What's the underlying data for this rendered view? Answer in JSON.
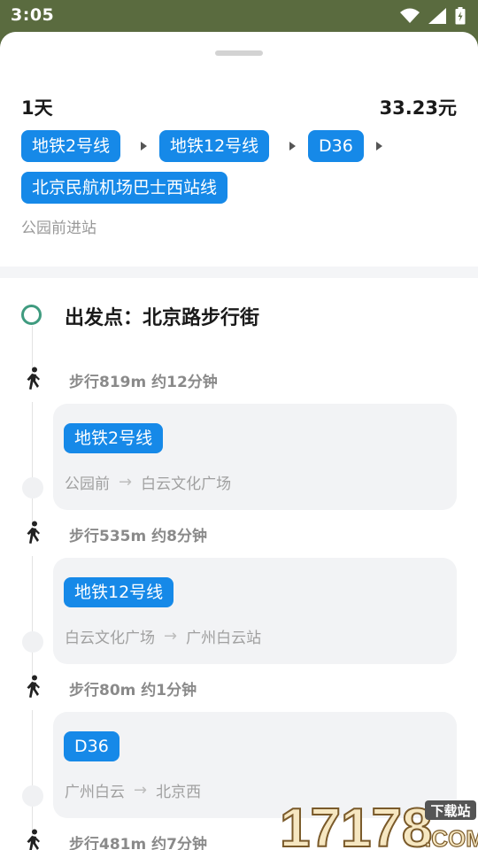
{
  "status_bar": {
    "time": "3:05"
  },
  "summary": {
    "days": "1天",
    "price": "33.23元",
    "lines": [
      "地铁2号线",
      "地铁12号线",
      "D36",
      "北京民航机场巴士西站线"
    ],
    "start_stop": "公园前进站"
  },
  "timeline": {
    "start_label": "出发点：北京路步行街",
    "steps": [
      {
        "walk": "步行819m 约12分钟",
        "line": "地铁2号线",
        "from": "公园前",
        "to": "白云文化广场"
      },
      {
        "walk": "步行535m 约8分钟",
        "line": "地铁12号线",
        "from": "白云文化广场",
        "to": "广州白云站"
      },
      {
        "walk": "步行80m 约1分钟",
        "line": "D36",
        "from": "广州白云",
        "to": "北京西"
      },
      {
        "walk": "步行481m 约7分钟"
      }
    ]
  },
  "watermark": {
    "text": "17178",
    "badge": "下载站",
    "suffix": ".COM"
  },
  "colors": {
    "accent": "#1689e8",
    "status_bar": "#5a6b3f",
    "start_ring": "#3f9b7f"
  },
  "icons": [
    "wifi-icon",
    "signal-icon",
    "battery-icon",
    "walk-icon",
    "arrow-right-icon"
  ]
}
